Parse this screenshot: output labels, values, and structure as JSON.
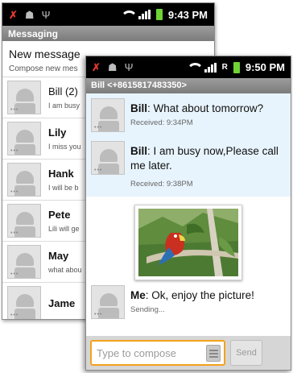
{
  "back_screen": {
    "status_time": "9:43 PM",
    "title": "Messaging",
    "new_message": {
      "title": "New message",
      "subtitle": "Compose new mes"
    },
    "conversations": [
      {
        "name": "Bill (2)",
        "preview": "I am busy",
        "bold": true
      },
      {
        "name": "Lily",
        "preview": "I miss you",
        "bold": true
      },
      {
        "name": "Hank",
        "preview": "I will be b",
        "bold": true
      },
      {
        "name": "Pete",
        "preview": "Lili will ge",
        "bold": true
      },
      {
        "name": "May",
        "preview": "what abou",
        "bold": true
      },
      {
        "name": "Jame",
        "preview": "",
        "bold": true
      }
    ]
  },
  "front_screen": {
    "status_time": "9:50 PM",
    "status_extra": "R",
    "title": "Bill <+8615817483350>",
    "messages": [
      {
        "sender": "Bill",
        "text": ": What about tomorrow?",
        "meta": "Received: 9:34PM"
      },
      {
        "sender": "Bill",
        "text": ": I am busy now,Please call me later.",
        "meta": "Received: 9:38PM"
      },
      {
        "sender": "Me",
        "text": ": Ok, enjoy the picture!",
        "meta": "Sending..."
      }
    ],
    "compose": {
      "placeholder": "Type to compose",
      "send_label": "Send"
    }
  },
  "colors": {
    "status_bar": "#000000",
    "title_bar": "#8a8a8a",
    "incoming_bg": "#e8f4fd",
    "compose_focus": "#f3a21c",
    "battery": "#6fd336",
    "missed_call": "#e23a2f"
  }
}
